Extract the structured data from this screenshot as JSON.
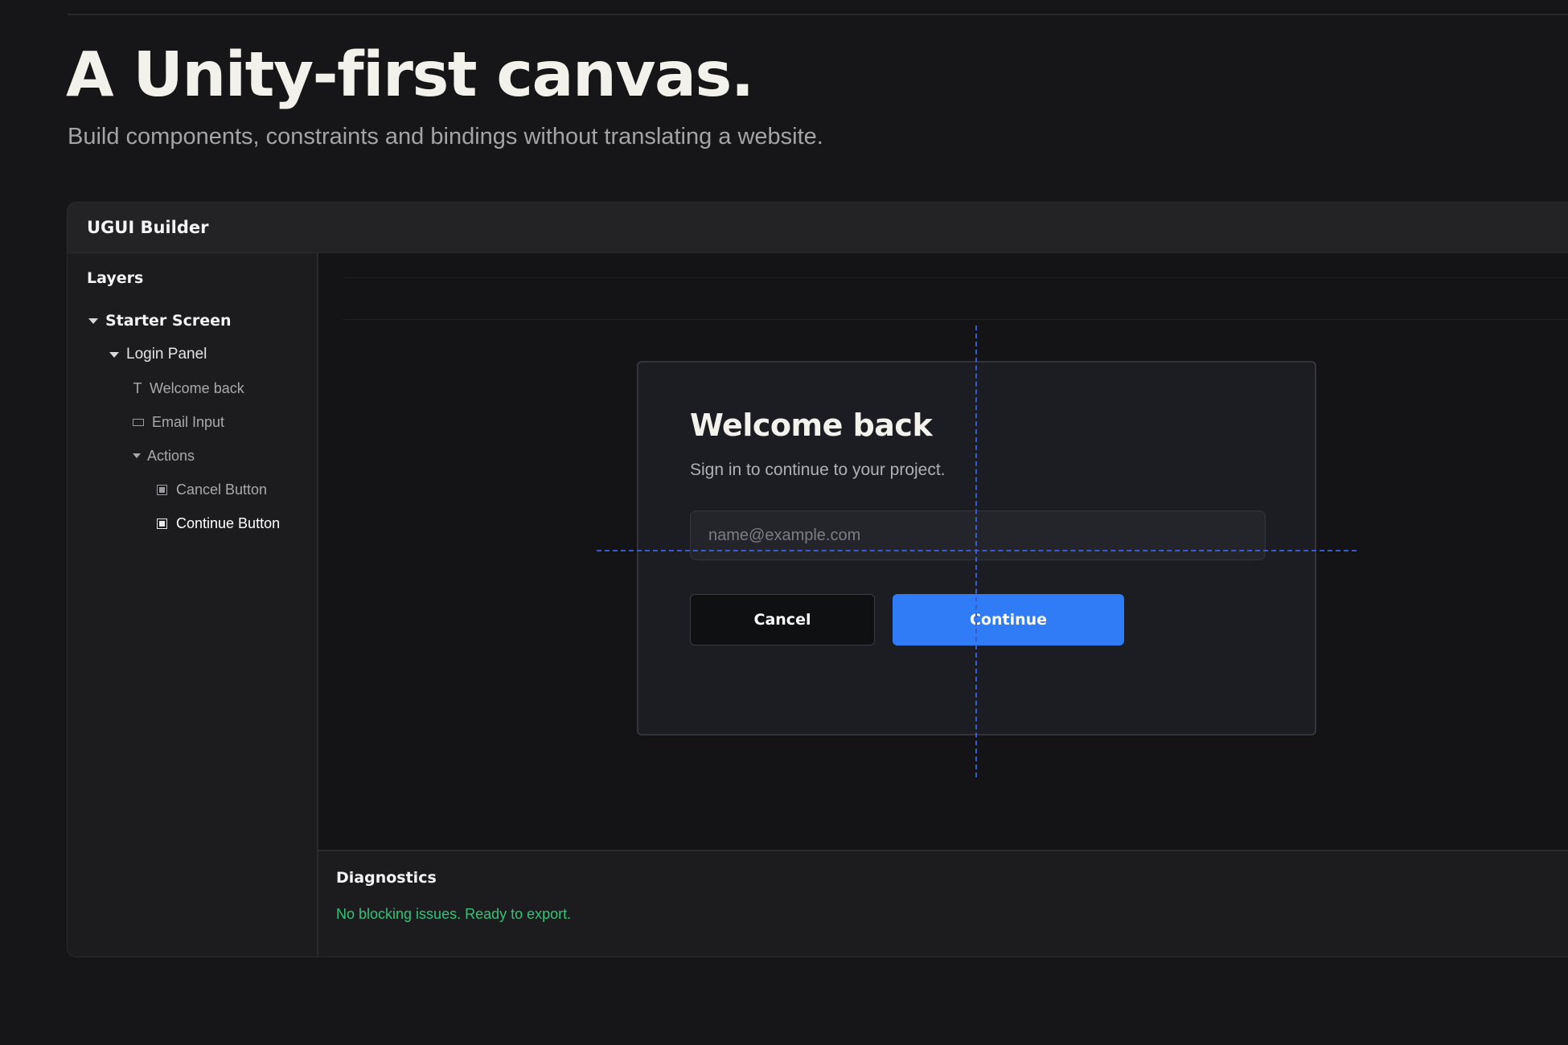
{
  "hero": {
    "title": "A Unity-first canvas.",
    "subtitle": "Build components, constraints and bindings without translating a website."
  },
  "builder": {
    "title": "UGUI Builder",
    "layers": {
      "heading": "Layers",
      "tree": [
        {
          "label": "Starter Screen",
          "type": "group",
          "expanded": true,
          "depth": 0
        },
        {
          "label": "Login Panel",
          "type": "group",
          "expanded": true,
          "depth": 1
        },
        {
          "label": "Welcome back",
          "type": "text",
          "depth": 2
        },
        {
          "label": "Email Input",
          "type": "input",
          "depth": 2
        },
        {
          "label": "Actions",
          "type": "group",
          "expanded": true,
          "depth": 2
        },
        {
          "label": "Cancel Button",
          "type": "button",
          "depth": 3
        },
        {
          "label": "Continue Button",
          "type": "button",
          "depth": 3,
          "selected": true
        }
      ]
    },
    "canvas": {
      "login_panel": {
        "title": "Welcome back",
        "subtitle": "Sign in to continue to your project.",
        "email_placeholder": "name@example.com",
        "email_value": "",
        "cancel_label": "Cancel",
        "continue_label": "Continue"
      }
    },
    "diagnostics": {
      "title": "Diagnostics",
      "status": "No blocking issues. Ready to export."
    }
  },
  "colors": {
    "background": "#161618",
    "accent": "#2f7cf6",
    "guide": "#3a5bd0",
    "success": "#34c278"
  },
  "icons": {
    "expanded": "caret-down-icon",
    "text": "text-icon",
    "input": "input-rect-icon",
    "button": "button-square-icon"
  }
}
